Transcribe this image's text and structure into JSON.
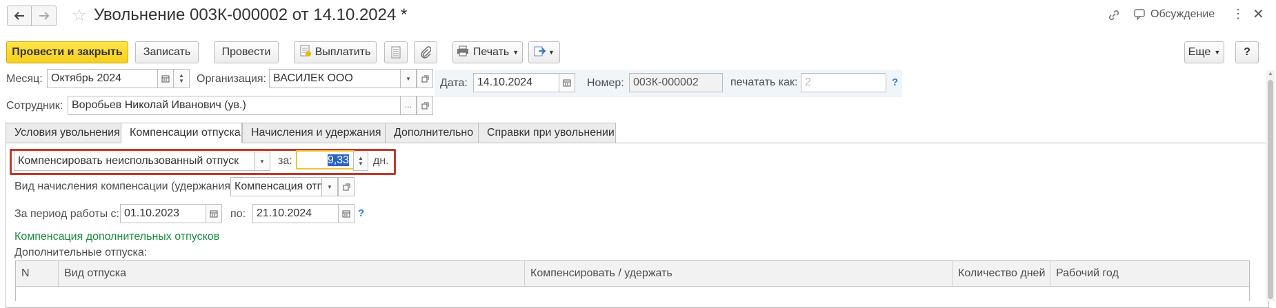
{
  "window": {
    "title": "Увольнение 003К-000002 от 14.10.2024 *",
    "discuss_label": "Обсуждение"
  },
  "toolbar": {
    "post_close": "Провести и закрыть",
    "save": "Записать",
    "post": "Провести",
    "pay": "Выплатить",
    "print": "Печать",
    "more": "Еще",
    "help": "?"
  },
  "header": {
    "month_label": "Месяц:",
    "month_value": "Октябрь 2024",
    "org_label": "Организация:",
    "org_value": "ВАСИЛЕК ООО",
    "date_label": "Дата:",
    "date_value": "14.10.2024",
    "number_label": "Номер:",
    "number_value": "003К-000002",
    "print_as_label": "печатать как:",
    "print_as_placeholder": "2",
    "employee_label": "Сотрудник:",
    "employee_value": "Воробьев Николай Иванович (ув.)",
    "help": "?"
  },
  "tabs": [
    {
      "label": "Условия увольнения"
    },
    {
      "label": "Компенсации отпуска"
    },
    {
      "label": "Начисления и удержания"
    },
    {
      "label": "Дополнительно"
    },
    {
      "label": "Справки при увольнении"
    }
  ],
  "compensation": {
    "mode_value": "Компенсировать неиспользованный отпуск",
    "for_label": "за:",
    "days_value": "9,33",
    "days_unit": "дн.",
    "accrual_label": "Вид начисления компенсации (удержания):",
    "accrual_value": "Компенсация отпуска",
    "period_from_label": "За период работы с:",
    "period_from_value": "01.10.2023",
    "period_to_label": "по:",
    "period_to_value": "21.10.2024",
    "help": "?",
    "additional_link": "Компенсация дополнительных отпусков",
    "additional_label": "Дополнительные отпуска:"
  },
  "table": {
    "columns": [
      "N",
      "Вид отпуска",
      "Компенсировать / удержать",
      "Количество дней",
      "Рабочий год"
    ]
  },
  "colors": {
    "primary_button": "#f5cf1d",
    "highlight_border": "#c0392b",
    "link_green": "#1a8a3a"
  }
}
